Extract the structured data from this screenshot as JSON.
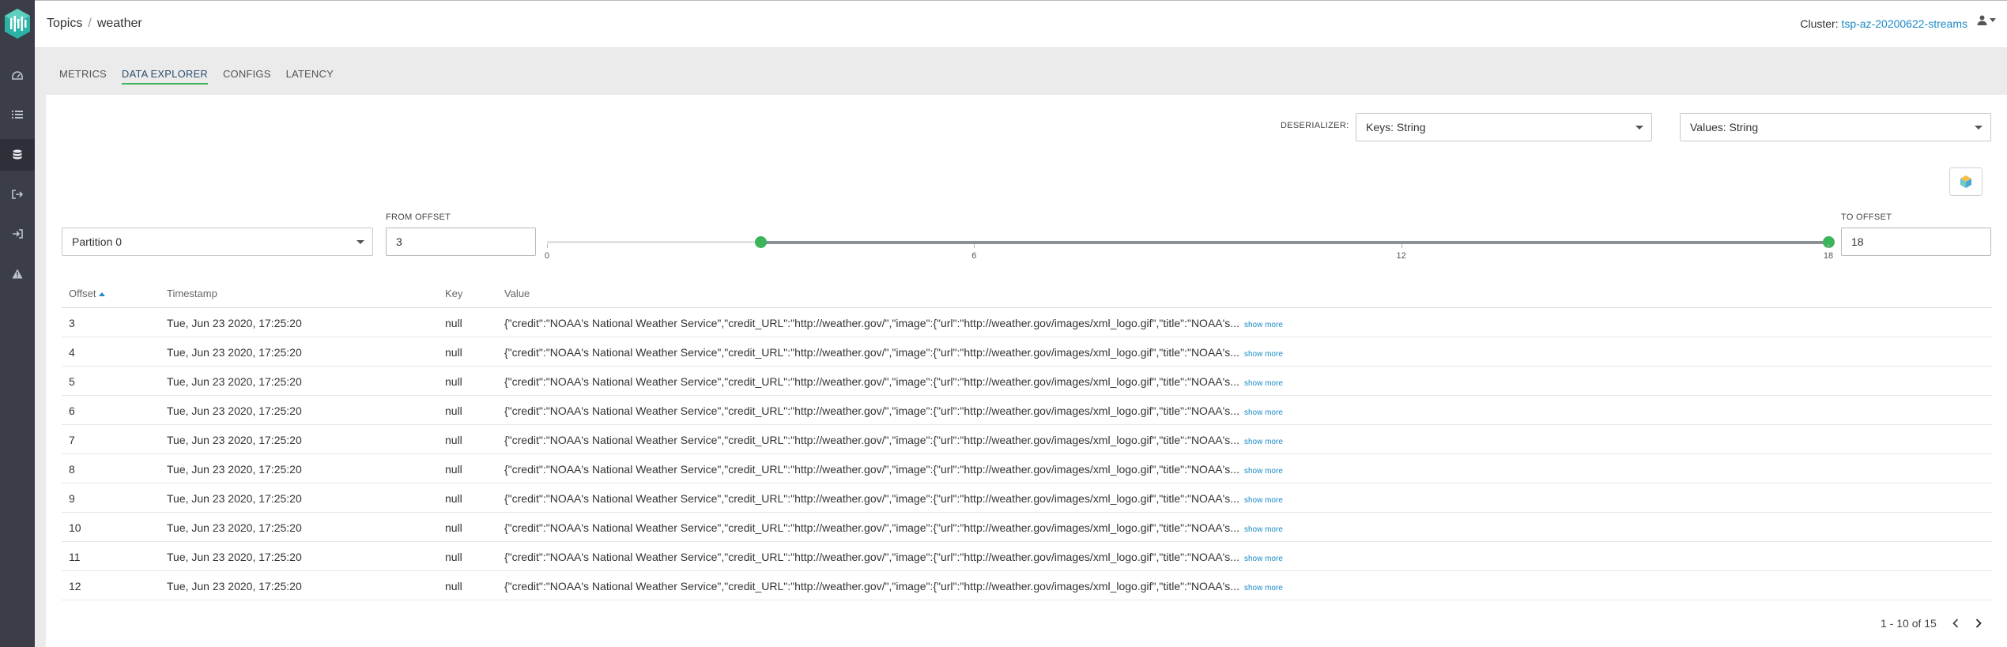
{
  "app": {
    "logo_icon": "kafka-stream-logo-icon",
    "sidebar_icons": [
      "dashboard-icon",
      "list-icon",
      "database-icon",
      "sign-out-icon",
      "sign-in-icon",
      "warning-icon"
    ]
  },
  "header": {
    "breadcrumb": [
      "Topics",
      "weather"
    ],
    "breadcrumb_separator": "/",
    "cluster_label": "Cluster:",
    "cluster_name": "tsp-az-20200622-streams",
    "user_icon": "user-icon"
  },
  "tabs": [
    {
      "label": "METRICS",
      "active": false
    },
    {
      "label": "DATA EXPLORER",
      "active": true
    },
    {
      "label": "CONFIGS",
      "active": false
    },
    {
      "label": "LATENCY",
      "active": false
    }
  ],
  "deserializer": {
    "label": "DESERIALIZER:",
    "keys_value": "Keys: String",
    "values_value": "Values: String"
  },
  "toolbar": {
    "cube_button_icon": "cube-icon"
  },
  "partition": {
    "value": "Partition 0"
  },
  "from_offset": {
    "label": "FROM OFFSET",
    "value": "3"
  },
  "to_offset": {
    "label": "TO OFFSET",
    "value": "18"
  },
  "slider": {
    "min": 0,
    "max": 18,
    "low": 3,
    "high": 18,
    "ticks": [
      "0",
      "6",
      "12",
      "18"
    ]
  },
  "table": {
    "columns": {
      "offset": "Offset",
      "timestamp": "Timestamp",
      "key": "Key",
      "value": "Value"
    },
    "sort_column": "Offset",
    "show_more_label": "show more",
    "rows": [
      {
        "offset": "3",
        "timestamp": "Tue, Jun 23 2020, 17:25:20",
        "key": "null",
        "value": "{\"credit\":\"NOAA's National Weather Service\",\"credit_URL\":\"http://weather.gov/\",\"image\":{\"url\":\"http://weather.gov/images/xml_logo.gif\",\"title\":\"NOAA's..."
      },
      {
        "offset": "4",
        "timestamp": "Tue, Jun 23 2020, 17:25:20",
        "key": "null",
        "value": "{\"credit\":\"NOAA's National Weather Service\",\"credit_URL\":\"http://weather.gov/\",\"image\":{\"url\":\"http://weather.gov/images/xml_logo.gif\",\"title\":\"NOAA's..."
      },
      {
        "offset": "5",
        "timestamp": "Tue, Jun 23 2020, 17:25:20",
        "key": "null",
        "value": "{\"credit\":\"NOAA's National Weather Service\",\"credit_URL\":\"http://weather.gov/\",\"image\":{\"url\":\"http://weather.gov/images/xml_logo.gif\",\"title\":\"NOAA's..."
      },
      {
        "offset": "6",
        "timestamp": "Tue, Jun 23 2020, 17:25:20",
        "key": "null",
        "value": "{\"credit\":\"NOAA's National Weather Service\",\"credit_URL\":\"http://weather.gov/\",\"image\":{\"url\":\"http://weather.gov/images/xml_logo.gif\",\"title\":\"NOAA's..."
      },
      {
        "offset": "7",
        "timestamp": "Tue, Jun 23 2020, 17:25:20",
        "key": "null",
        "value": "{\"credit\":\"NOAA's National Weather Service\",\"credit_URL\":\"http://weather.gov/\",\"image\":{\"url\":\"http://weather.gov/images/xml_logo.gif\",\"title\":\"NOAA's..."
      },
      {
        "offset": "8",
        "timestamp": "Tue, Jun 23 2020, 17:25:20",
        "key": "null",
        "value": "{\"credit\":\"NOAA's National Weather Service\",\"credit_URL\":\"http://weather.gov/\",\"image\":{\"url\":\"http://weather.gov/images/xml_logo.gif\",\"title\":\"NOAA's..."
      },
      {
        "offset": "9",
        "timestamp": "Tue, Jun 23 2020, 17:25:20",
        "key": "null",
        "value": "{\"credit\":\"NOAA's National Weather Service\",\"credit_URL\":\"http://weather.gov/\",\"image\":{\"url\":\"http://weather.gov/images/xml_logo.gif\",\"title\":\"NOAA's..."
      },
      {
        "offset": "10",
        "timestamp": "Tue, Jun 23 2020, 17:25:20",
        "key": "null",
        "value": "{\"credit\":\"NOAA's National Weather Service\",\"credit_URL\":\"http://weather.gov/\",\"image\":{\"url\":\"http://weather.gov/images/xml_logo.gif\",\"title\":\"NOAA's..."
      },
      {
        "offset": "11",
        "timestamp": "Tue, Jun 23 2020, 17:25:20",
        "key": "null",
        "value": "{\"credit\":\"NOAA's National Weather Service\",\"credit_URL\":\"http://weather.gov/\",\"image\":{\"url\":\"http://weather.gov/images/xml_logo.gif\",\"title\":\"NOAA's..."
      },
      {
        "offset": "12",
        "timestamp": "Tue, Jun 23 2020, 17:25:20",
        "key": "null",
        "value": "{\"credit\":\"NOAA's National Weather Service\",\"credit_URL\":\"http://weather.gov/\",\"image\":{\"url\":\"http://weather.gov/images/xml_logo.gif\",\"title\":\"NOAA's..."
      }
    ]
  },
  "pagination": {
    "text": "1 - 10 of 15"
  },
  "colors": {
    "accent_green": "#3bb45a",
    "link_blue": "#1a8ac6",
    "sidebar_bg": "#3b3e47"
  }
}
